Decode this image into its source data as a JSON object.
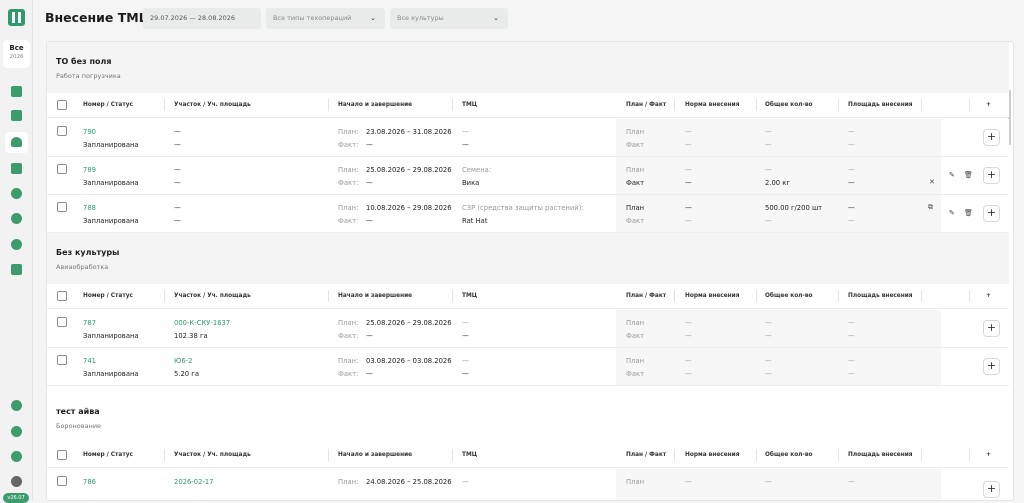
{
  "header": {
    "title": "Внесение ТМЦ",
    "date_range": "29.07.2026 — 28.08.2026",
    "operation_type_placeholder": "Все типы техопераций",
    "crop_placeholder": "Все культуры"
  },
  "sidebar": {
    "season_label": "Все",
    "season_year": "2026",
    "version": "v26.07"
  },
  "columns": {
    "number_status": "Номер / Статус",
    "area": "Участок / Уч. площадь",
    "start_end": "Начало и завершение",
    "tmc": "ТМЦ",
    "plan_fact": "План / Факт",
    "norm": "Норма внесения",
    "total": "Общее кол-во",
    "application_area": "Площадь внесения",
    "add": "+"
  },
  "labels": {
    "plan": "План:",
    "fact": "Факт:",
    "plan_short": "План",
    "fact_short": "Факт",
    "dash": "—",
    "add": "+"
  },
  "groups": [
    {
      "title": "ТО без поля",
      "subtitle": "Работа погрузчика",
      "rows": [
        {
          "number": "790",
          "status": "Запланирована",
          "field": "—",
          "area": "—",
          "plan_dates": "23.08.2026 – 31.08.2026",
          "fact_dates": "—",
          "tmc_type": "—",
          "tmc_name": "—",
          "plan_fact_1": "План",
          "plan_fact_2": "Факт",
          "norm_1": "—",
          "norm_2": "—",
          "total_1": "—",
          "total_2": "—",
          "apparea_1": "—",
          "apparea_2": "—"
        },
        {
          "number": "789",
          "status": "Запланирована",
          "field": "—",
          "area": "—",
          "plan_dates": "25.08.2026 – 29.08.2026",
          "fact_dates": "—",
          "tmc_type": "Семена:",
          "tmc_name": "Вика",
          "plan_fact_1": "План",
          "plan_fact_2": "Факт",
          "norm_1": "—",
          "norm_2": "—",
          "total_1": "—",
          "total_2": "2.00 кг",
          "apparea_1": "—",
          "apparea_2": "—"
        },
        {
          "number": "788",
          "status": "Запланирована",
          "field": "—",
          "area": "—",
          "plan_dates": "10.08.2026 – 29.08.2026",
          "fact_dates": "—",
          "tmc_type": "СЗР (средства защиты растений):",
          "tmc_name": "Rat Hat",
          "plan_fact_1": "План",
          "plan_fact_2": "Факт",
          "norm_1": "—",
          "norm_2": "—",
          "total_1": "500.00 г/200 шт",
          "total_2": "—",
          "apparea_1": "—",
          "apparea_2": "—"
        }
      ]
    },
    {
      "title": "Без культуры",
      "subtitle": "Авиаобработка",
      "rows": [
        {
          "number": "787",
          "status": "Запланирована",
          "field": "000-К-СКУ-1637",
          "area": "102.38 га",
          "plan_dates": "25.08.2026 – 29.08.2026",
          "fact_dates": "—",
          "tmc_type": "—",
          "tmc_name": "—",
          "plan_fact_1": "План",
          "plan_fact_2": "Факт",
          "norm_1": "—",
          "norm_2": "—",
          "total_1": "—",
          "total_2": "—",
          "apparea_1": "—",
          "apparea_2": "—"
        },
        {
          "number": "741",
          "status": "Запланирована",
          "field": "Ю6-2",
          "area": "5.20 га",
          "plan_dates": "03.08.2026 – 03.08.2026",
          "fact_dates": "—",
          "tmc_type": "—",
          "tmc_name": "—",
          "plan_fact_1": "План",
          "plan_fact_2": "Факт",
          "norm_1": "—",
          "norm_2": "—",
          "total_1": "—",
          "total_2": "—",
          "apparea_1": "—",
          "apparea_2": "—"
        }
      ]
    },
    {
      "title": "тест айва",
      "subtitle": "Боронование",
      "rows": [
        {
          "number": "786",
          "status": "Запланирована",
          "field": "2026-02-17",
          "area": "",
          "plan_dates": "24.08.2026 – 25.08.2026",
          "fact_dates": "",
          "tmc_type": "—",
          "tmc_name": "",
          "plan_fact_1": "План",
          "plan_fact_2": "",
          "norm_1": "—",
          "norm_2": "",
          "total_1": "—",
          "total_2": "",
          "apparea_1": "—",
          "apparea_2": ""
        }
      ]
    }
  ]
}
